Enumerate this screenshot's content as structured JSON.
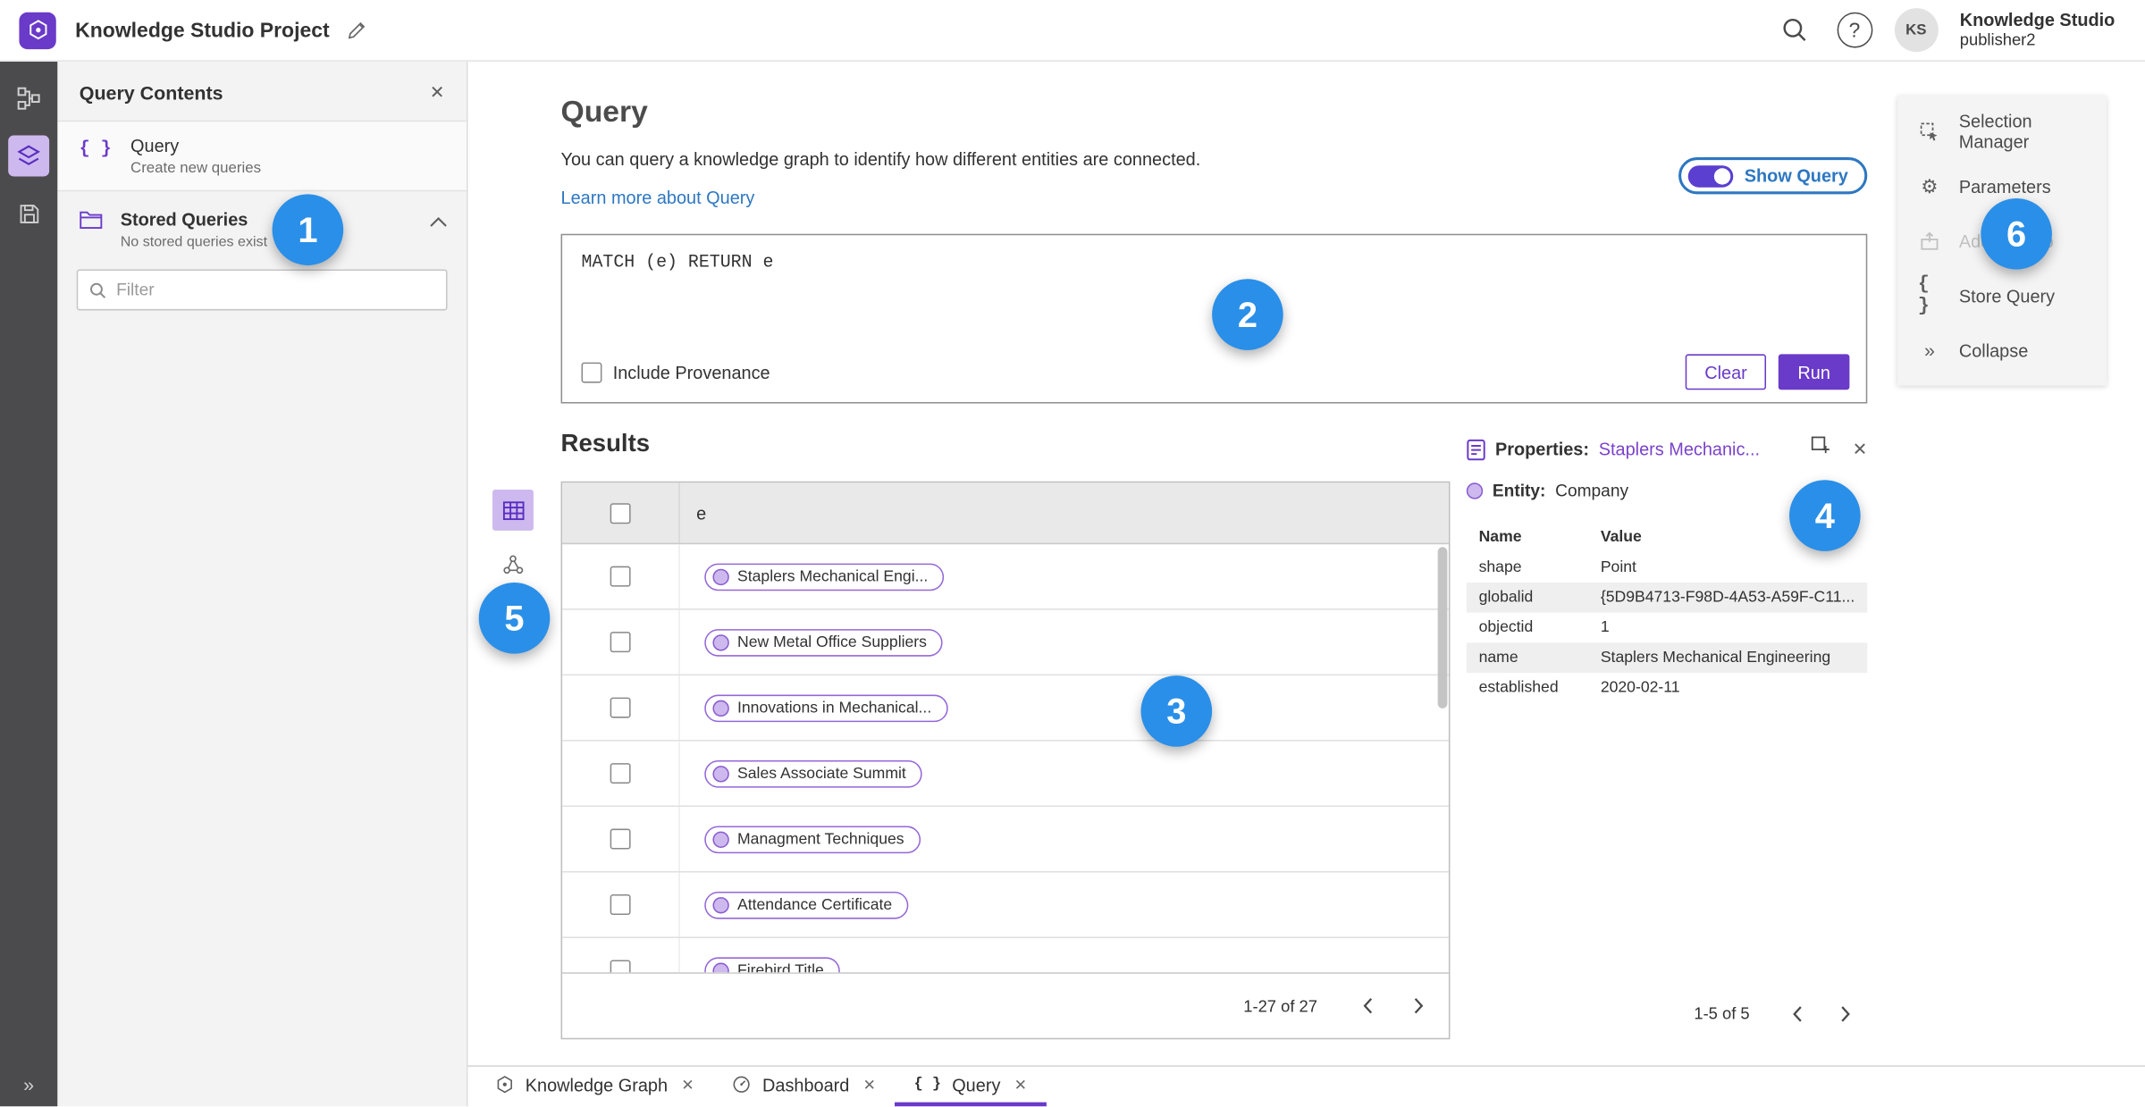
{
  "colors": {
    "accent_purple": "#6a3ac9",
    "link_blue": "#2d77c2",
    "badge_blue": "#2a8fe8"
  },
  "app": {
    "title": "Knowledge Studio Project",
    "user": {
      "initials": "KS",
      "name": "Knowledge Studio",
      "role": "publisher2"
    }
  },
  "query_contents": {
    "title": "Query Contents",
    "query_item": {
      "label": "Query",
      "sublabel": "Create new queries"
    },
    "stored_queries": {
      "label": "Stored Queries",
      "sublabel": "No stored queries exist"
    },
    "filter_placeholder": "Filter"
  },
  "query": {
    "heading": "Query",
    "description": "You can query a knowledge graph to identify how different entities are connected.",
    "learn_more": "Learn more about Query",
    "show_query": "Show Query",
    "expression": "MATCH (e) RETURN e",
    "include_provenance": "Include Provenance",
    "clear": "Clear",
    "run": "Run"
  },
  "results": {
    "heading": "Results",
    "column": "e",
    "rows": [
      "Staplers Mechanical Engi...",
      "New Metal Office Suppliers",
      "Innovations in Mechanical...",
      "Sales Associate Summit",
      "Managment Techniques",
      "Attendance Certificate",
      "Firebird Title"
    ],
    "pagination": "1-27 of 27"
  },
  "properties": {
    "label": "Properties:",
    "entity_link": "Staplers Mechanic...",
    "entity_label": "Entity:",
    "entity_value": "Company",
    "col_name": "Name",
    "col_value": "Value",
    "rows": [
      {
        "name": "shape",
        "value": "Point"
      },
      {
        "name": "globalid",
        "value": "{5D9B4713-F98D-4A53-A59F-C11..."
      },
      {
        "name": "objectid",
        "value": "1"
      },
      {
        "name": "name",
        "value": "Staplers Mechanical Engineering"
      },
      {
        "name": "established",
        "value": "2020-02-11"
      }
    ],
    "pagination": "1-5 of 5"
  },
  "tools_menu": {
    "items": [
      {
        "label": "Selection Manager"
      },
      {
        "label": "Parameters"
      },
      {
        "label": "Add To Map"
      },
      {
        "label": "Store Query"
      },
      {
        "label": "Collapse"
      }
    ]
  },
  "tabs": [
    {
      "label": "Knowledge Graph"
    },
    {
      "label": "Dashboard"
    },
    {
      "label": "Query"
    }
  ],
  "annotations": [
    "1",
    "2",
    "3",
    "4",
    "5",
    "6"
  ]
}
